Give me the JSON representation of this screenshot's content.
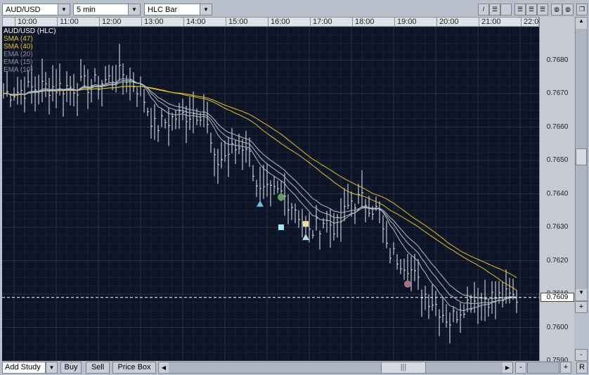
{
  "toolbar": {
    "symbol": "AUD/USD",
    "interval": "5 min",
    "chart_type": "HLC Bar"
  },
  "legend": [
    {
      "label": "AUD/USD (HLC)",
      "color": "#ffffff"
    },
    {
      "label": "SMA (47)",
      "color": "#e8c020"
    },
    {
      "label": "SMA (40)",
      "color": "#e8c020"
    },
    {
      "label": "EMA (20)",
      "color": "#8a8f9a"
    },
    {
      "label": "EMA (15)",
      "color": "#8a8f9a"
    },
    {
      "label": "EMA (10)",
      "color": "#8a8f9a"
    }
  ],
  "time_labels": [
    "10:00",
    "11:00",
    "12:00",
    "13:00",
    "14:00",
    "15:00",
    "16:00",
    "17:00",
    "18:00",
    "19:00",
    "20:00",
    "21:00",
    "22:00"
  ],
  "price_labels": [
    "0.7680",
    "0.7670",
    "0.7660",
    "0.7650",
    "0.7640",
    "0.7630",
    "0.7620",
    "0.7610",
    "0.7600",
    "0.7590"
  ],
  "current_price": "0.7609",
  "bottom": {
    "add_study": "Add Study",
    "buy": "Buy",
    "sell": "Sell",
    "price_box": "Price Box",
    "zoom_out": "-",
    "zoom_in": "+",
    "reset": "R"
  },
  "chart_data": {
    "type": "hlc-bar",
    "interval_minutes": 5,
    "close_anchors": [
      [
        "09:45",
        0.767
      ],
      [
        "10:40",
        0.7672
      ],
      [
        "11:20",
        0.7672
      ],
      [
        "12:00",
        0.7673
      ],
      [
        "12:35",
        0.7676
      ],
      [
        "13:00",
        0.7671
      ],
      [
        "13:20",
        0.766
      ],
      [
        "13:50",
        0.7663
      ],
      [
        "14:30",
        0.7665
      ],
      [
        "14:45",
        0.7649
      ],
      [
        "15:10",
        0.7653
      ],
      [
        "15:30",
        0.7655
      ],
      [
        "15:50",
        0.764
      ],
      [
        "16:20",
        0.764
      ],
      [
        "16:40",
        0.7636
      ],
      [
        "17:00",
        0.7628
      ],
      [
        "17:20",
        0.7632
      ],
      [
        "17:40",
        0.763
      ],
      [
        "18:00",
        0.7638
      ],
      [
        "18:20",
        0.7638
      ],
      [
        "18:40",
        0.7634
      ],
      [
        "18:50",
        0.7623
      ],
      [
        "19:20",
        0.7619
      ],
      [
        "19:40",
        0.7611
      ],
      [
        "20:00",
        0.7607
      ],
      [
        "20:20",
        0.7602
      ],
      [
        "20:40",
        0.7607
      ],
      [
        "21:00",
        0.7609
      ],
      [
        "21:55",
        0.7609
      ]
    ],
    "studies": [
      {
        "name": "SMA",
        "period": 47
      },
      {
        "name": "SMA",
        "period": 40
      },
      {
        "name": "EMA",
        "period": 20
      },
      {
        "name": "EMA",
        "period": 15
      },
      {
        "name": "EMA",
        "period": 10
      }
    ],
    "markers": [
      {
        "type": "triangle",
        "time": "15:50",
        "price": 0.7637,
        "color": "#6fb8f0"
      },
      {
        "type": "triangle",
        "time": "16:55",
        "price": 0.7627,
        "color": "#9fe0f0"
      },
      {
        "type": "circle",
        "time": "16:20",
        "price": 0.7639,
        "color": "#6a9a6a"
      },
      {
        "type": "circle",
        "time": "19:20",
        "price": 0.7613,
        "color": "#b07080"
      },
      {
        "type": "square",
        "time": "16:20",
        "price": 0.763,
        "color": "#a0e8f8"
      },
      {
        "type": "square",
        "time": "16:55",
        "price": 0.7631,
        "color": "#f0e0a0"
      }
    ],
    "ylim": [
      0.759,
      0.769
    ]
  }
}
